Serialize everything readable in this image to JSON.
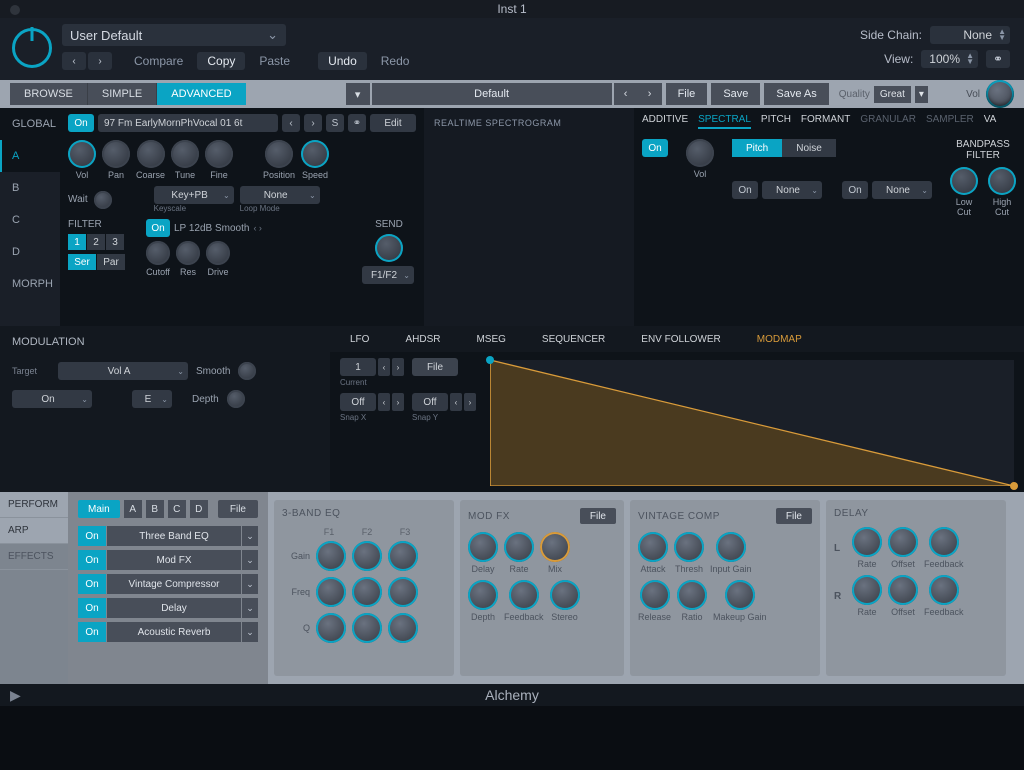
{
  "title": "Inst 1",
  "host": {
    "preset": "User Default",
    "compare": "Compare",
    "copy": "Copy",
    "paste": "Paste",
    "undo": "Undo",
    "redo": "Redo",
    "sidechain_label": "Side Chain:",
    "sidechain_value": "None",
    "view_label": "View:",
    "view_value": "100%"
  },
  "greybar": {
    "tabs": [
      "BROWSE",
      "SIMPLE",
      "ADVANCED"
    ],
    "preset": "Default",
    "file": "File",
    "save": "Save",
    "saveas": "Save As",
    "quality_label": "Quality",
    "quality_value": "Great",
    "vol": "Vol"
  },
  "leftnav": [
    "GLOBAL",
    "A",
    "B",
    "C",
    "D",
    "MORPH"
  ],
  "source": {
    "on": "On",
    "name": "97 Fm EarlyMornPhVocal 01 6t",
    "s": "S",
    "edit": "Edit",
    "knobs": [
      "Vol",
      "Pan",
      "Coarse",
      "Tune",
      "Fine",
      "Position",
      "Speed"
    ],
    "wait": "Wait",
    "keyscale": "Key+PB",
    "keyscale_sub": "Keyscale",
    "loopmode": "None",
    "loopmode_sub": "Loop Mode",
    "filter_hdr": "FILTER",
    "filter_nums": [
      "1",
      "2",
      "3"
    ],
    "ser": "Ser",
    "par": "Par",
    "filter_on": "On",
    "filter_type": "LP 12dB Smooth",
    "filter_knobs": [
      "Cutoff",
      "Res",
      "Drive"
    ],
    "send_hdr": "SEND",
    "send_val": "F1/F2"
  },
  "spectro": "REALTIME SPECTROGRAM",
  "spectral": {
    "tabs": [
      "ADDITIVE",
      "SPECTRAL",
      "PITCH",
      "FORMANT",
      "GRANULAR",
      "SAMPLER",
      "VA"
    ],
    "on": "On",
    "vol": "Vol",
    "pitch": "Pitch",
    "noise": "Noise",
    "none": "None",
    "bpf": "BANDPASS FILTER",
    "lowcut": "Low Cut",
    "highcut": "High Cut"
  },
  "mod": {
    "hdr": "MODULATION",
    "target": "Target",
    "target_val": "Vol A",
    "smooth": "Smooth",
    "on": "On",
    "e": "E",
    "depth": "Depth",
    "tabs": [
      "LFO",
      "AHDSR",
      "MSEG",
      "SEQUENCER",
      "ENV FOLLOWER",
      "MODMAP"
    ],
    "current": "1",
    "current_sub": "Current",
    "file": "File",
    "snapx": "Off",
    "snapx_sub": "Snap X",
    "snapy": "Off",
    "snapy_sub": "Snap Y"
  },
  "fxnav": [
    "PERFORM",
    "ARP",
    "EFFECTS"
  ],
  "fxtop": {
    "main": "Main",
    "letters": [
      "A",
      "B",
      "C",
      "D"
    ],
    "file": "File"
  },
  "fxlist": [
    "Three Band EQ",
    "Mod FX",
    "Vintage Compressor",
    "Delay",
    "Acoustic Reverb"
  ],
  "fx_on": "On",
  "eq": {
    "title": "3-BAND EQ",
    "cols": [
      "F1",
      "F2",
      "F3"
    ],
    "rows": [
      "Gain",
      "Freq",
      "Q"
    ]
  },
  "modfx": {
    "title": "MOD FX",
    "file": "File",
    "r1": [
      "Delay",
      "Rate",
      "Mix"
    ],
    "r2": [
      "Depth",
      "Feedback",
      "Stereo"
    ]
  },
  "comp": {
    "title": "VINTAGE COMP",
    "file": "File",
    "r1": [
      "Attack",
      "Thresh",
      "Input Gain"
    ],
    "r2": [
      "Release",
      "Ratio",
      "Makeup Gain"
    ]
  },
  "delay": {
    "title": "DELAY",
    "L": "L",
    "R": "R",
    "cols": [
      "Rate",
      "Offset",
      "Feedback"
    ]
  },
  "footer": "Alchemy"
}
